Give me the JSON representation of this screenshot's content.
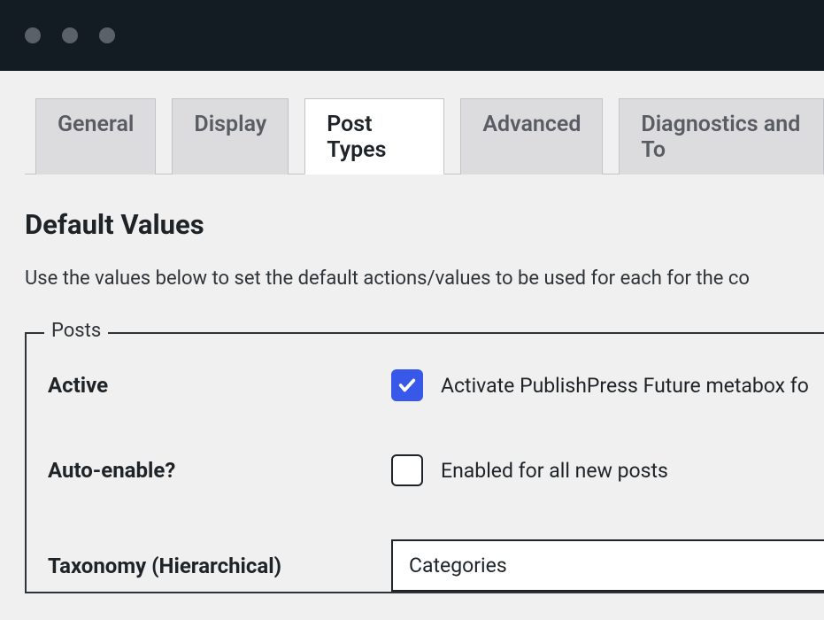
{
  "tabs": [
    {
      "label": "General",
      "active": false
    },
    {
      "label": "Display",
      "active": false
    },
    {
      "label": "Post Types",
      "active": true
    },
    {
      "label": "Advanced",
      "active": false
    },
    {
      "label": "Diagnostics and To",
      "active": false
    }
  ],
  "section": {
    "title": "Default Values",
    "description": "Use the values below to set the default actions/values to be used for each for the co"
  },
  "fieldset": {
    "legend": "Posts",
    "rows": {
      "active": {
        "label": "Active",
        "checked": true,
        "text": "Activate PublishPress Future metabox fo"
      },
      "autoEnable": {
        "label": "Auto-enable?",
        "checked": false,
        "text": "Enabled for all new posts"
      },
      "taxonomy": {
        "label": "Taxonomy (Hierarchical)",
        "value": "Categories"
      }
    }
  }
}
